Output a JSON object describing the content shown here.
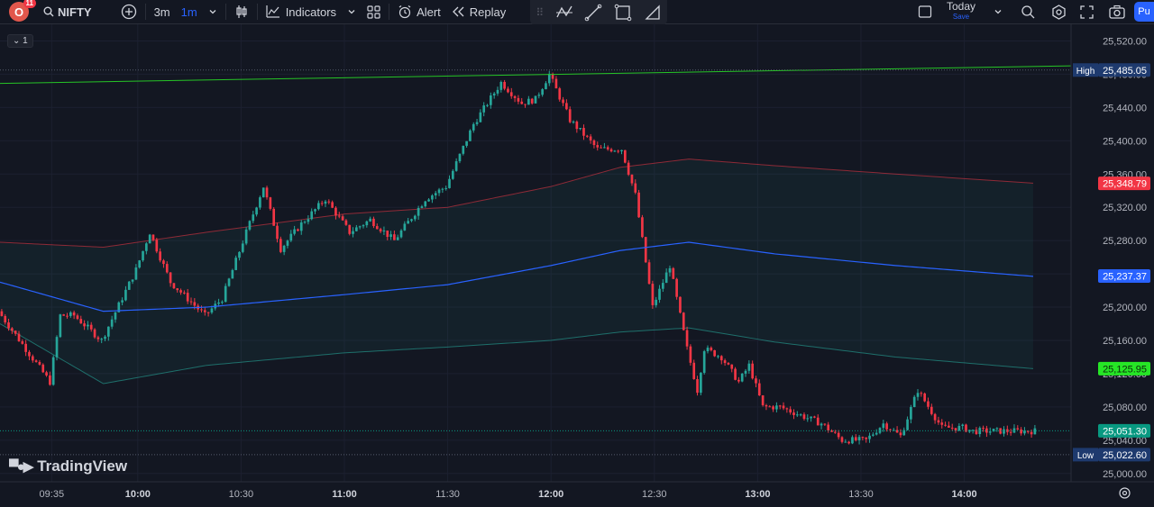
{
  "toolbar": {
    "avatar_letter": "O",
    "avatar_badge": "11",
    "symbol": "NIFTY",
    "interval_primary": "3m",
    "interval_selected": "1m",
    "indicators_label": "Indicators",
    "alert_label": "Alert",
    "replay_label": "Replay",
    "today_label": "Today",
    "save_label": "Save",
    "publish_label": "Pu"
  },
  "legend_toggle": "1",
  "logo_text": "TradingView",
  "colors": {
    "up": "#26a69a",
    "down": "#f23645",
    "vwap": "#2962ff",
    "upper_band": "#f23645",
    "lower_band": "#26a69a",
    "trend": "#26c426"
  },
  "chart_data": {
    "type": "candlestick",
    "ylim": [
      24990,
      25540
    ],
    "y_ticks": [
      "25,520.00",
      "25,480.00",
      "25,440.00",
      "25,400.00",
      "25,360.00",
      "25,320.00",
      "25,280.00",
      "25,240.00",
      "25,200.00",
      "25,160.00",
      "25,120.00",
      "25,080.00",
      "25,040.00",
      "25,000.00"
    ],
    "y_tick_values": [
      25520,
      25480,
      25440,
      25400,
      25360,
      25320,
      25280,
      25240,
      25200,
      25160,
      25120,
      25080,
      25040,
      25000
    ],
    "x_ticks": [
      "09:35",
      "10:00",
      "10:30",
      "11:00",
      "11:30",
      "12:00",
      "12:30",
      "13:00",
      "13:30",
      "14:00"
    ],
    "x_tick_minutes": [
      575,
      600,
      630,
      660,
      690,
      720,
      750,
      780,
      810,
      840
    ],
    "x_bold": [
      false,
      true,
      false,
      true,
      false,
      true,
      false,
      true,
      false,
      true
    ],
    "x_range_minutes": [
      560,
      871
    ],
    "price_labels": [
      {
        "text": "25,485.05",
        "value": 25485.05,
        "tag": "High",
        "bg": "#1e3a6e",
        "fg": "#ffffff"
      },
      {
        "text": "25,348.79",
        "value": 25348.79,
        "tag": "",
        "bg": "#f23645",
        "fg": "#ffffff"
      },
      {
        "text": "25,237.37",
        "value": 25237.37,
        "tag": "",
        "bg": "#2962ff",
        "fg": "#ffffff"
      },
      {
        "text": "25,125.95",
        "value": 25125.95,
        "tag": "",
        "bg": "#26e626",
        "fg": "#0b2a0b"
      },
      {
        "text": "25,051.30",
        "value": 25051.3,
        "tag": "",
        "bg": "#089981",
        "fg": "#ffffff"
      },
      {
        "text": "25,022.60",
        "value": 25022.6,
        "tag": "Low",
        "bg": "#1e3a6e",
        "fg": "#ffffff"
      }
    ],
    "trend_line": {
      "x": [
        560,
        860
      ],
      "y": [
        25469,
        25490
      ]
    },
    "vwap_anchors": {
      "x": [
        560,
        590,
        620,
        660,
        690,
        720,
        740,
        760,
        785,
        820,
        860
      ],
      "y": [
        25230,
        25195,
        25200,
        25215,
        25227,
        25250,
        25268,
        25278,
        25264,
        25250,
        25237
      ]
    },
    "upper_anchors": {
      "x": [
        560,
        590,
        620,
        660,
        690,
        720,
        740,
        760,
        785,
        820,
        860
      ],
      "y": [
        25278,
        25272,
        25290,
        25312,
        25320,
        25345,
        25368,
        25378,
        25370,
        25360,
        25349
      ]
    },
    "lower_anchors": {
      "x": [
        560,
        590,
        620,
        660,
        690,
        720,
        740,
        760,
        785,
        820,
        860
      ],
      "y": [
        25180,
        25108,
        25130,
        25145,
        25152,
        25160,
        25170,
        25175,
        25158,
        25140,
        25126
      ]
    },
    "path_anchors": {
      "x": [
        560,
        575,
        578,
        582,
        590,
        600,
        604,
        610,
        620,
        625,
        632,
        637,
        642,
        648,
        655,
        662,
        668,
        675,
        684,
        690,
        698,
        706,
        712,
        716,
        720,
        726,
        734,
        741,
        745,
        750,
        755,
        760,
        763,
        765,
        770,
        775,
        778,
        782,
        787,
        793,
        799,
        805,
        812,
        817,
        822,
        827,
        834,
        840,
        843
      ],
      "y": [
        25195,
        25110,
        25190,
        25190,
        25160,
        25245,
        25290,
        25230,
        25190,
        25210,
        25290,
        25345,
        25270,
        25300,
        25330,
        25290,
        25305,
        25280,
        25330,
        25345,
        25420,
        25470,
        25445,
        25450,
        25480,
        25425,
        25390,
        25390,
        25335,
        25200,
        25250,
        25150,
        25100,
        25150,
        25140,
        25110,
        25130,
        25080,
        25080,
        25070,
        25060,
        25040,
        25040,
        25060,
        25045,
        25100,
        25055,
        25055,
        25051
      ]
    }
  }
}
